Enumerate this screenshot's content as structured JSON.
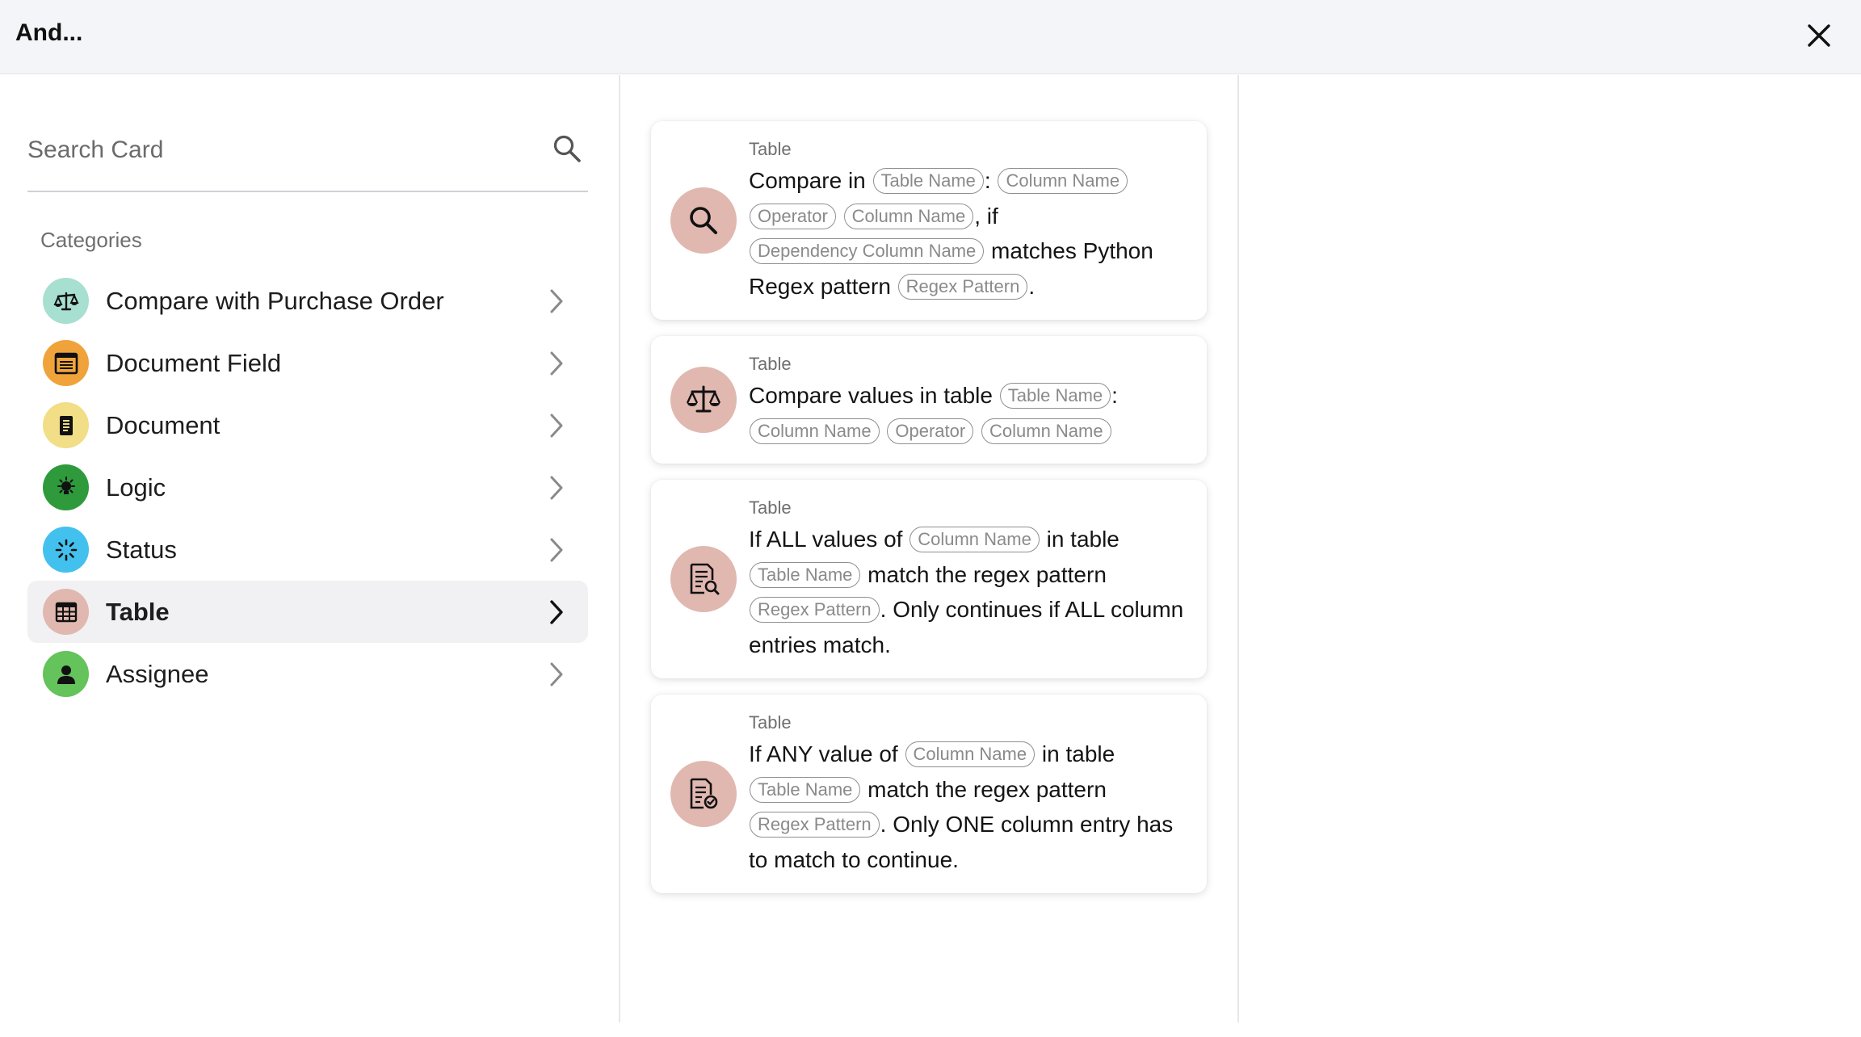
{
  "header": {
    "title": "And..."
  },
  "search": {
    "placeholder": "Search Card"
  },
  "categories": {
    "heading": "Categories",
    "items": [
      {
        "label": "Compare with Purchase Order",
        "icon": "balance-scale-icon",
        "color": "#a7dfd0"
      },
      {
        "label": "Document Field",
        "icon": "form-field-icon",
        "color": "#f0a33a"
      },
      {
        "label": "Document",
        "icon": "document-icon",
        "color": "#f1de86"
      },
      {
        "label": "Logic",
        "icon": "lightbulb-icon",
        "color": "#2e9a3b"
      },
      {
        "label": "Status",
        "icon": "status-spinner-icon",
        "color": "#43c1ee"
      },
      {
        "label": "Table",
        "icon": "table-grid-icon",
        "color": "#e0b8b0",
        "selected": true
      },
      {
        "label": "Assignee",
        "icon": "person-icon",
        "color": "#64c35a"
      }
    ]
  },
  "cards": [
    {
      "category": "Table",
      "icon": "magnifier-icon",
      "parts": [
        {
          "t": "text",
          "v": "Compare in "
        },
        {
          "t": "chip",
          "v": "Table Name"
        },
        {
          "t": "text",
          "v": ": "
        },
        {
          "t": "chip",
          "v": "Column Name"
        },
        {
          "t": "text",
          "v": " "
        },
        {
          "t": "chip",
          "v": "Operator"
        },
        {
          "t": "text",
          "v": " "
        },
        {
          "t": "chip",
          "v": "Column Name"
        },
        {
          "t": "text",
          "v": ", if "
        },
        {
          "t": "chip",
          "v": "Dependency Column Name"
        },
        {
          "t": "text",
          "v": " matches Python Regex pattern "
        },
        {
          "t": "chip",
          "v": "Regex Pattern"
        },
        {
          "t": "text",
          "v": "."
        }
      ]
    },
    {
      "category": "Table",
      "icon": "balance-scale-icon",
      "parts": [
        {
          "t": "text",
          "v": "Compare values in table "
        },
        {
          "t": "chip",
          "v": "Table Name"
        },
        {
          "t": "text",
          "v": ": "
        },
        {
          "t": "chip",
          "v": "Column Name"
        },
        {
          "t": "text",
          "v": " "
        },
        {
          "t": "chip",
          "v": "Operator"
        },
        {
          "t": "text",
          "v": " "
        },
        {
          "t": "chip",
          "v": "Column Name"
        }
      ]
    },
    {
      "category": "Table",
      "icon": "document-search-icon",
      "parts": [
        {
          "t": "text",
          "v": "If ALL values of "
        },
        {
          "t": "chip",
          "v": "Column Name"
        },
        {
          "t": "text",
          "v": " in table "
        },
        {
          "t": "chip",
          "v": "Table Name"
        },
        {
          "t": "text",
          "v": " match the regex pattern "
        },
        {
          "t": "chip",
          "v": "Regex Pattern"
        },
        {
          "t": "text",
          "v": ". Only continues if ALL column entries match."
        }
      ]
    },
    {
      "category": "Table",
      "icon": "document-check-icon",
      "parts": [
        {
          "t": "text",
          "v": "If ANY value of "
        },
        {
          "t": "chip",
          "v": "Column Name"
        },
        {
          "t": "text",
          "v": " in table "
        },
        {
          "t": "chip",
          "v": "Table Name"
        },
        {
          "t": "text",
          "v": " match the regex pattern "
        },
        {
          "t": "chip",
          "v": "Regex Pattern"
        },
        {
          "t": "text",
          "v": ". Only ONE column entry has to match to continue."
        }
      ]
    }
  ]
}
